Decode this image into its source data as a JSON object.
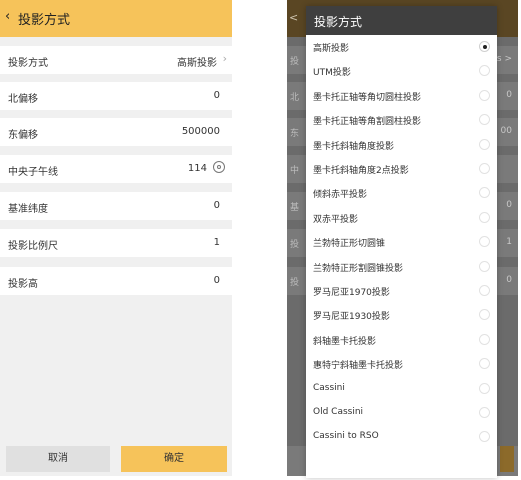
{
  "left": {
    "header": {
      "back_icon": "chevron-left",
      "title": "投影方式"
    },
    "rows": [
      {
        "label": "投影方式",
        "value": "高斯投影",
        "trailing": "chevron-right"
      },
      {
        "label": "北偏移",
        "value": "0"
      },
      {
        "label": "东偏移",
        "value": "500000"
      },
      {
        "label": "中央子午线",
        "value": "114",
        "trailing": "location-icon"
      },
      {
        "label": "基准纬度",
        "value": "0"
      },
      {
        "label": "投影比例尺",
        "value": "1"
      },
      {
        "label": "投影高",
        "value": "0"
      }
    ],
    "buttons": {
      "cancel": "取消",
      "ok": "确定"
    }
  },
  "right_background": {
    "header_back_fragment": "<",
    "rows": [
      {
        "label": "投",
        "value": "s >"
      },
      {
        "label": "北",
        "value": "0"
      },
      {
        "label": "东",
        "value": "00"
      },
      {
        "label": "中",
        "value": ""
      },
      {
        "label": "基",
        "value": "0"
      },
      {
        "label": "投",
        "value": "1"
      },
      {
        "label": "投",
        "value": "0"
      }
    ]
  },
  "dialog": {
    "title": "投影方式",
    "selected_index": 0,
    "options": [
      "高斯投影",
      "UTM投影",
      "墨卡托正轴等角切圆柱投影",
      "墨卡托正轴等角割圆柱投影",
      "墨卡托斜轴角度投影",
      "墨卡托斜轴角度2点投影",
      "倾斜赤平投影",
      "双赤平投影",
      "兰勃特正形切圆锥",
      "兰勃特正形割圆锥投影",
      "罗马尼亚1970投影",
      "罗马尼亚1930投影",
      "斜轴墨卡托投影",
      "惠特宁斜轴墨卡托投影",
      "Cassini",
      "Old Cassini",
      "Cassini to RSO"
    ]
  },
  "colors": {
    "accent": "#f6c35a",
    "dialog_header": "#3f3f3f",
    "background": "#f0f0f0"
  }
}
